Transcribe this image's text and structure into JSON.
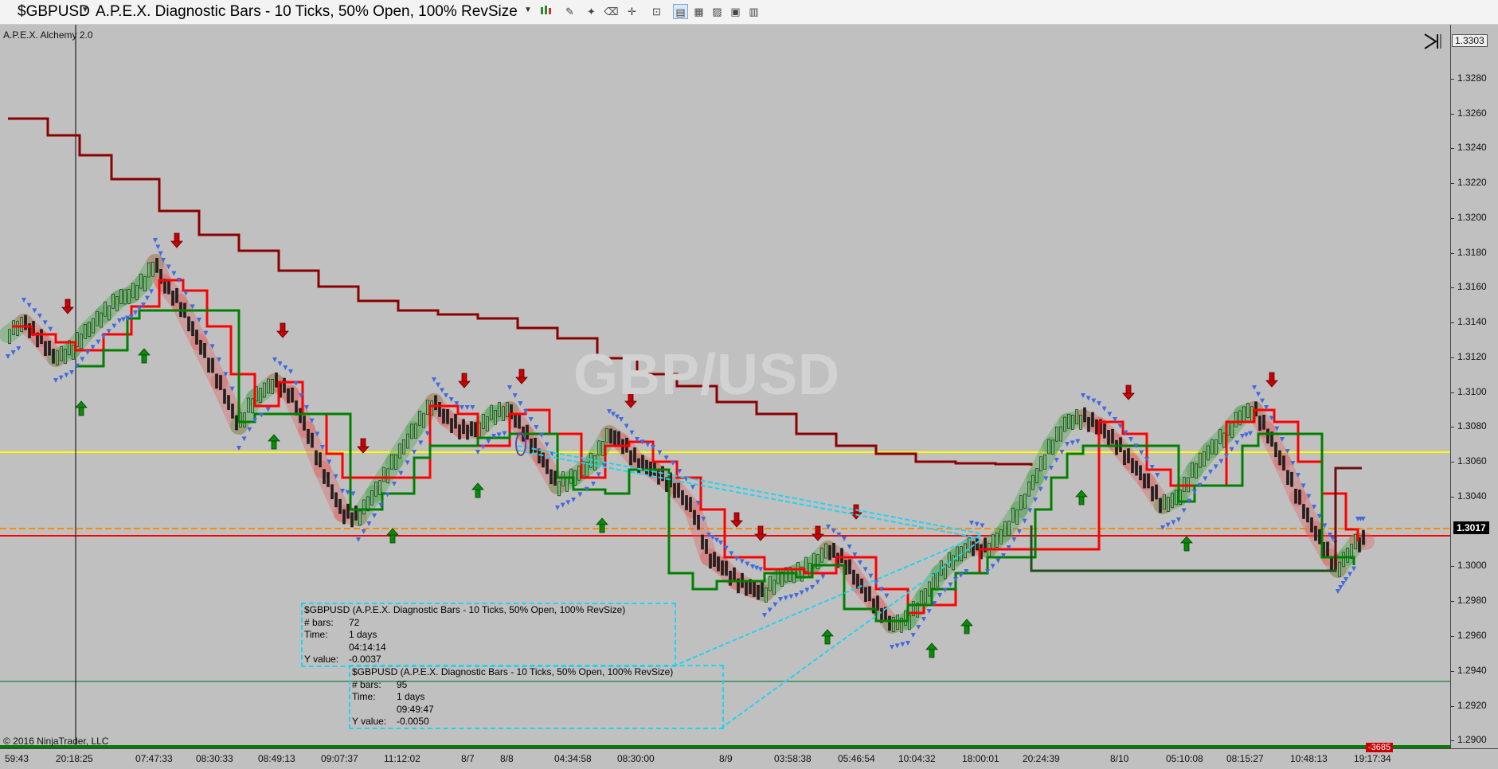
{
  "toolbar": {
    "instrument": "$GBPUSD",
    "bar_type": "A.P.E.X. Diagnostic Bars - 10 Ticks, 50% Open, 100% RevSize",
    "icons": [
      "candlestick-icon",
      "pencil-icon",
      "pin-icon",
      "eraser-icon",
      "crosshair-icon",
      "zoom-icon",
      "data-box-icon",
      "indicators-icon",
      "chart-image-icon",
      "save-icon",
      "properties-icon"
    ]
  },
  "chart": {
    "indicator_label": "A.P.E.X. Alchemy 2.0",
    "watermark": "GBP/USD",
    "copyright": "© 2016 NinjaTrader, LLC",
    "last_price": "1.3017",
    "top_price": "1.3303",
    "bottom_badge": "-3685",
    "y_ticks": [
      "1.3280",
      "1.3260",
      "1.3240",
      "1.3220",
      "1.3200",
      "1.3180",
      "1.3160",
      "1.3140",
      "1.3120",
      "1.3100",
      "1.3080",
      "1.3060",
      "1.3040",
      "1.3000",
      "1.2980",
      "1.2960",
      "1.2940",
      "1.2920",
      "1.2900"
    ],
    "x_ticks": [
      "59:43",
      "20:18:25",
      "07:47:33",
      "08:30:33",
      "08:49:13",
      "09:07:37",
      "11:12:02",
      "8/7",
      "8/8",
      "04:34:58",
      "08:30:00",
      "8/9",
      "03:58:38",
      "05:46:54",
      "10:04:32",
      "18:00:01",
      "20:24:39",
      "8/10",
      "05:10:08",
      "08:15:27",
      "10:48:13",
      "19:17:34"
    ],
    "colors": {
      "background": "#c0c0c0",
      "sma": "#8b0000",
      "bull_trail": "#008000",
      "bear_trail": "#ff0000",
      "dots": "#4169e1",
      "yellow_line": "#ffff00",
      "orange_line": "#ff8c00",
      "red_line": "#ff0000",
      "green_line": "#2e8b57",
      "measure": "#22d3ee"
    }
  },
  "measure1": {
    "title": "$GBPUSD (A.P.E.X. Diagnostic Bars - 10 Ticks, 50% Open, 100% RevSize)",
    "bars_label": "# bars:",
    "bars": "72",
    "time_label": "Time:",
    "time_days": "1 days",
    "time_hms": "04:14:14",
    "y_label": "Y value:",
    "y_value": "-0.0037"
  },
  "measure2": {
    "title": "$GBPUSD (A.P.E.X. Diagnostic Bars - 10 Ticks, 50% Open, 100% RevSize)",
    "bars_label": "# bars:",
    "bars": "95",
    "time_label": "Time:",
    "time_days": "1 days",
    "time_hms": "09:49:47",
    "y_label": "Y value:",
    "y_value": "-0.0050"
  }
}
